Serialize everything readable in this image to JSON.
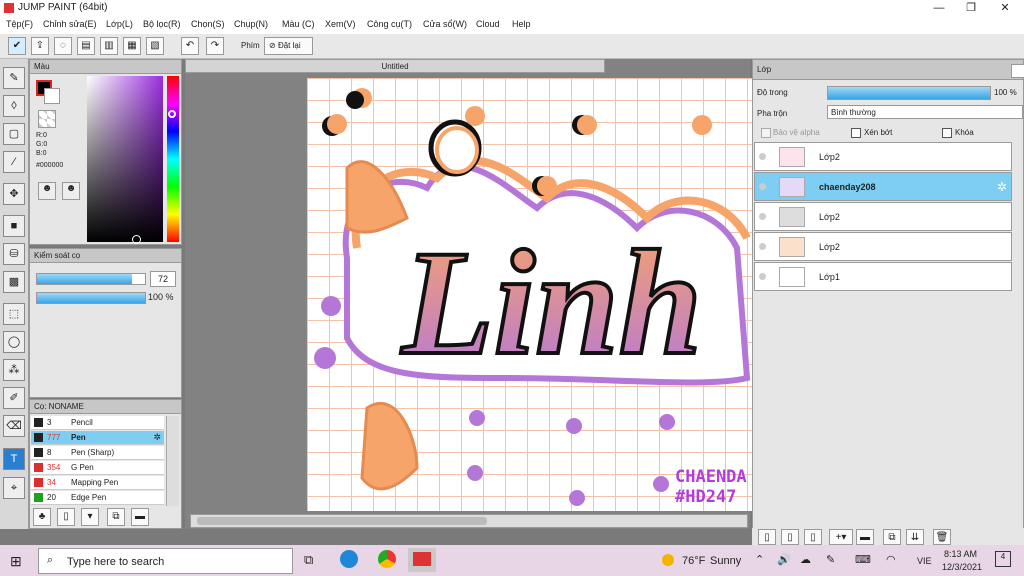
{
  "window": {
    "title": "JUMP PAINT (64bit)",
    "min": "—",
    "max": "❐",
    "close": "✕"
  },
  "menu": [
    "Tệp(F)",
    "Chỉnh sửa(E)",
    "Lớp(L)",
    "Bộ lọc(R)",
    "Chọn(S)",
    "Chụp(N)",
    "Màu (C)",
    "Xem(V)",
    "Công cụ(T)",
    "Cửa sổ(W)",
    "Cloud",
    "Help"
  ],
  "toolbar": {
    "phim_label": "Phím",
    "reset_label": "Đặt lại",
    "reset_icon": "no-icon"
  },
  "color_panel": {
    "title": "Màu",
    "r": "R:0",
    "g": "G:0",
    "b": "B:0",
    "hex": "#000000",
    "main_color": "#000000"
  },
  "brush_control": {
    "title": "Kiểm soát cọ",
    "size": "72",
    "opacity": "100 %"
  },
  "brush_panel": {
    "title": "Cọ: NONAME",
    "items": [
      {
        "size": "3",
        "name": "Pencil",
        "color": "#222222"
      },
      {
        "size": "777",
        "name": "Pen",
        "color": "#222222"
      },
      {
        "size": "8",
        "name": "Pen (Sharp)",
        "color": "#222222"
      },
      {
        "size": "354",
        "name": "G Pen",
        "color": "#d83030"
      },
      {
        "size": "34",
        "name": "Mapping Pen",
        "color": "#d83030"
      },
      {
        "size": "20",
        "name": "Edge Pen",
        "color": "#20a020"
      }
    ]
  },
  "document": {
    "tab": "Untitled",
    "text_big": "Linh",
    "watermark1": "CHAENDA",
    "watermark2": "#HD247"
  },
  "layer_panel": {
    "title": "Lớp",
    "opacity_label": "Độ trong",
    "opacity_value": "100 %",
    "blend_label": "Pha trộn",
    "blend_value": "Bình thường",
    "protect_alpha": "Bảo vệ alpha",
    "clipping": "Xén bớt",
    "lock": "Khóa",
    "layers": [
      {
        "name": "Lớp2",
        "selected": false
      },
      {
        "name": "chaenday208",
        "selected": true
      },
      {
        "name": "Lớp2",
        "selected": false
      },
      {
        "name": "Lớp2",
        "selected": false
      },
      {
        "name": "Lớp1",
        "selected": false
      }
    ]
  },
  "taskbar": {
    "search_placeholder": "Type here to search",
    "temp": "76°F",
    "weather": "Sunny",
    "lang": "VIE",
    "time": "8:13 AM",
    "date": "12/3/2021",
    "notif": "4"
  }
}
